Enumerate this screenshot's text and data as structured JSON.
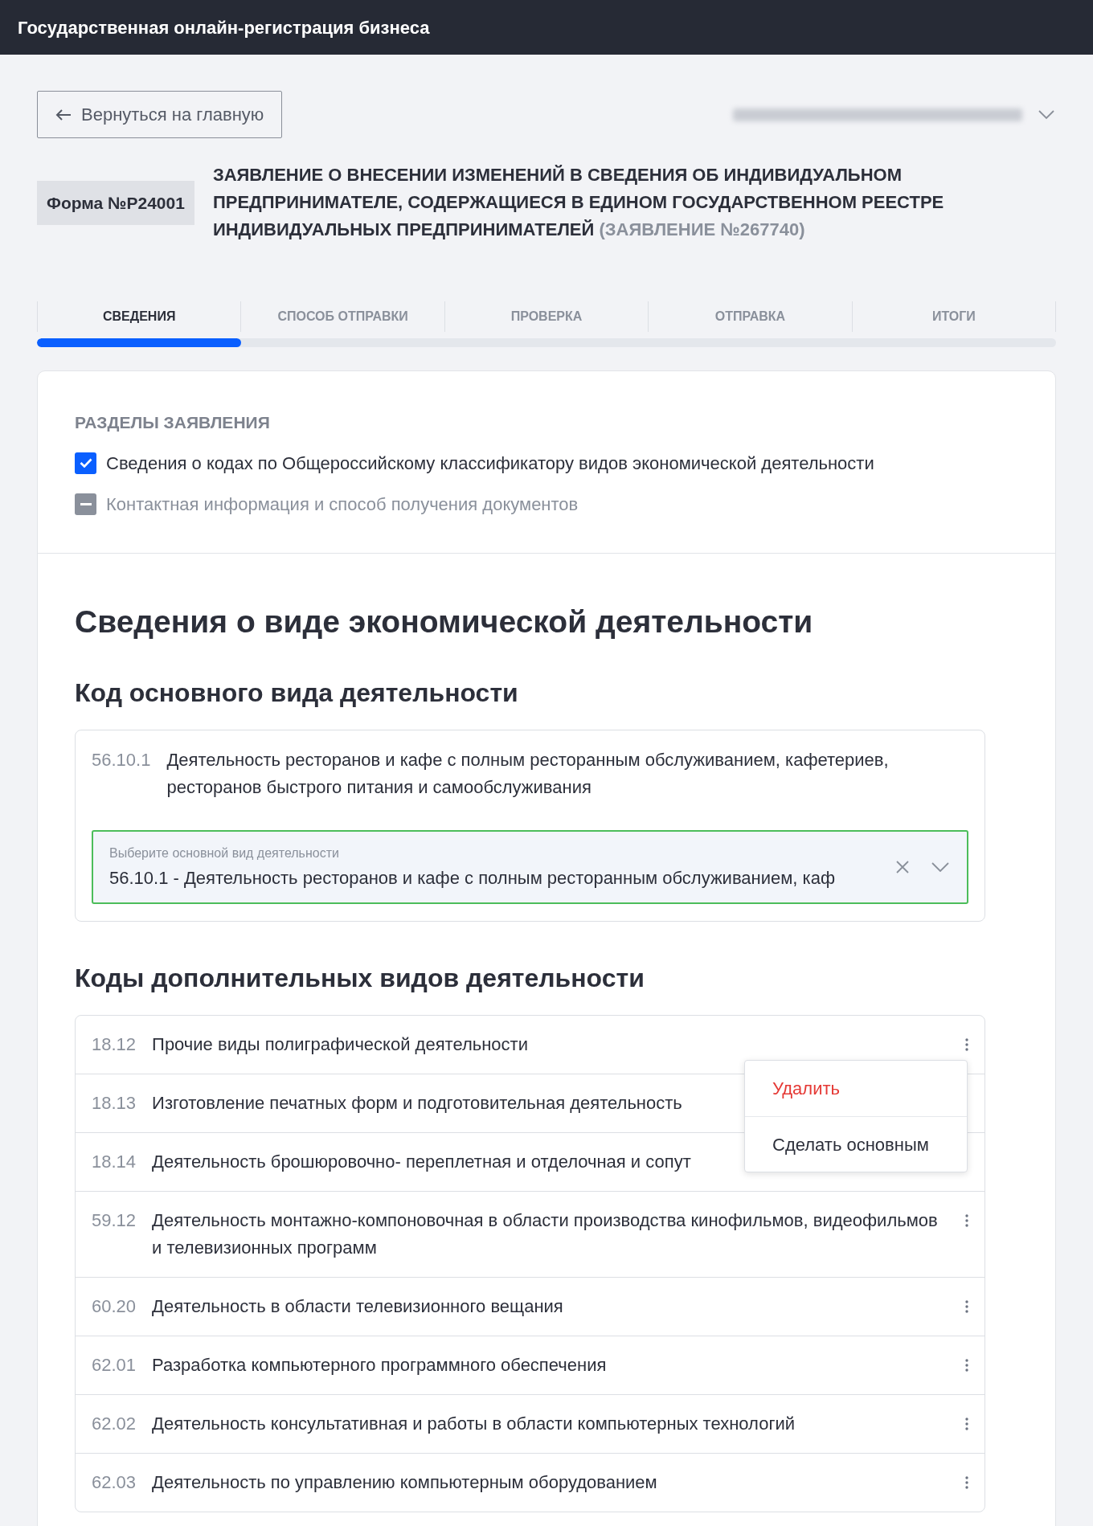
{
  "header": {
    "title": "Государственная онлайн-регистрация бизнеса"
  },
  "back_button": {
    "label": "Вернуться на главную"
  },
  "form": {
    "badge": "Форма №Р24001",
    "title": "ЗАЯВЛЕНИЕ О ВНЕСЕНИИ ИЗМЕНЕНИЙ В СВЕДЕНИЯ ОБ ИНДИВИДУАЛЬНОМ ПРЕДПРИНИМАТЕЛЕ, СОДЕРЖАЩИЕСЯ В ЕДИНОМ ГОСУДАРСТВЕННОМ РЕЕСТРЕ ИНДИВИДУАЛЬНЫХ ПРЕДПРИНИМАТЕЛЕЙ",
    "number": "(ЗАЯВЛЕНИЕ №267740)"
  },
  "tabs": [
    {
      "label": "СВЕДЕНИЯ",
      "selected": true
    },
    {
      "label": "СПОСОБ ОТПРАВКИ",
      "selected": false
    },
    {
      "label": "ПРОВЕРКА",
      "selected": false
    },
    {
      "label": "ОТПРАВКА",
      "selected": false
    },
    {
      "label": "ИТОГИ",
      "selected": false
    }
  ],
  "progress": {
    "level": 0.2
  },
  "sections": {
    "title": "РАЗДЕЛЫ ЗАЯВЛЕНИЯ",
    "items": [
      {
        "label": "Сведения о кодах по Общероссийскому классификатору видов экономической деятельности",
        "checked": true,
        "indeterminate": false
      },
      {
        "label": "Контактная информация и способ получения документов",
        "checked": false,
        "indeterminate": true
      }
    ]
  },
  "heading": "Сведения о виде экономической деятельности",
  "main_activity": {
    "heading": "Код основного вида деятельности",
    "code": "56.10.1",
    "description": "Деятельность ресторанов и кафе с полным ресторанным обслуживанием, кафетериев, ресторанов быстрого питания и самообслуживания",
    "select": {
      "label": "Выберите основной вид деятельности",
      "value": "56.10.1 - Деятельность ресторанов и кафе с полным ресторанным обслуживанием, каф"
    }
  },
  "additional": {
    "heading": "Коды дополнительных видов деятельности",
    "rows": [
      {
        "code": "18.12",
        "description": "Прочие виды полиграфической деятельности",
        "menu_icon": true
      },
      {
        "code": "18.13",
        "description": "Изготовление печатных форм и подготовительная деятельность",
        "menu_icon": false
      },
      {
        "code": "18.14",
        "description": "Деятельность брошюровочно- переплетная и отделочная и сопут",
        "menu_icon": false
      },
      {
        "code": "59.12",
        "description": "Деятельность монтажно-компоновочная в области производства кинофильмов, видеофильмов и телевизионных программ",
        "menu_icon": true
      },
      {
        "code": "60.20",
        "description": "Деятельность в области телевизионного вещания",
        "menu_icon": true
      },
      {
        "code": "62.01",
        "description": "Разработка компьютерного программного обеспечения",
        "menu_icon": true
      },
      {
        "code": "62.02",
        "description": "Деятельность консультативная и работы в области компьютерных технологий",
        "menu_icon": true
      },
      {
        "code": "62.03",
        "description": "Деятельность по управлению компьютерным оборудованием",
        "menu_icon": true
      }
    ]
  },
  "context_menu": {
    "items": [
      {
        "label": "Удалить",
        "kind": "danger"
      },
      {
        "label": "Сделать основным",
        "kind": "normal"
      }
    ]
  }
}
